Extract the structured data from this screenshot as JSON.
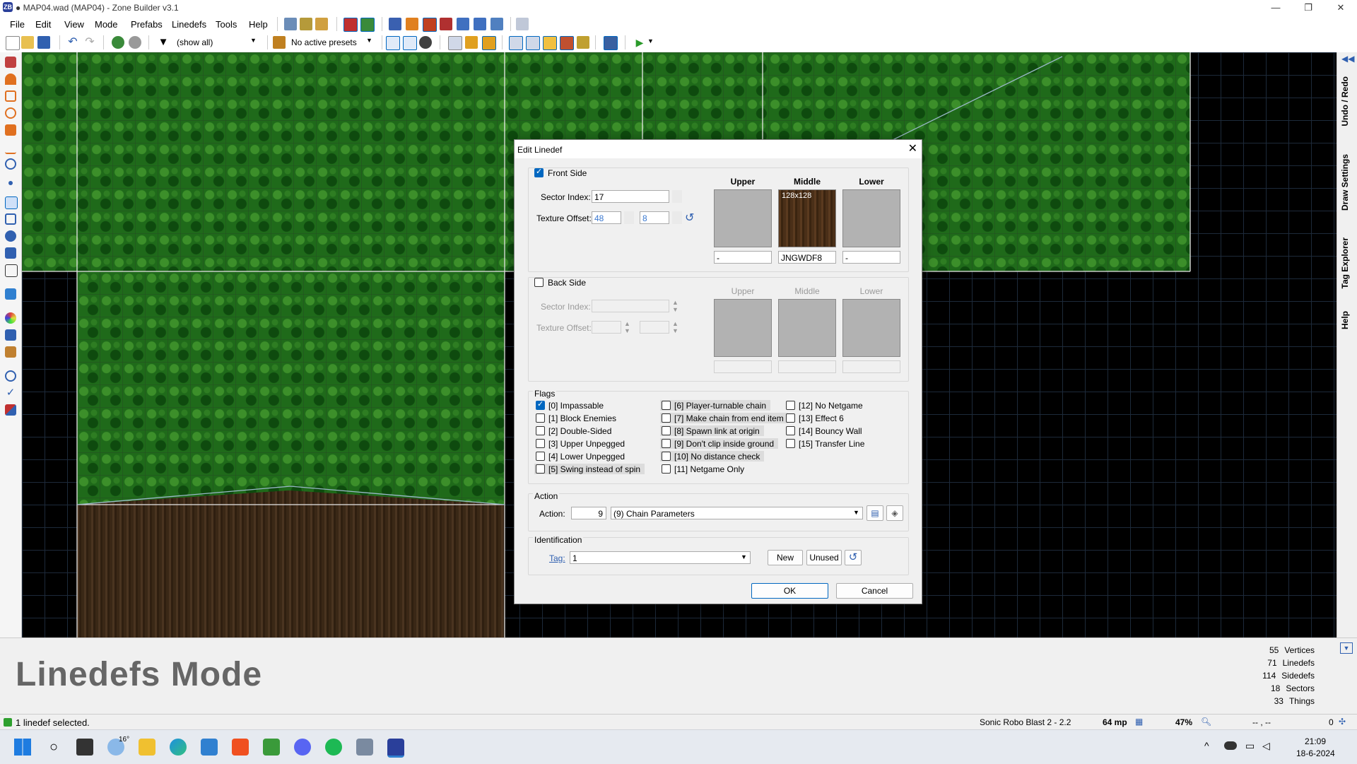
{
  "window": {
    "title": "● MAP04.wad (MAP04) - Zone Builder v3.1",
    "app_icon": "ZB",
    "controls": [
      "—",
      "❐",
      "✕"
    ]
  },
  "menu": [
    "File",
    "Edit",
    "View",
    "Mode",
    "Prefabs",
    "Linedefs",
    "Tools",
    "Help"
  ],
  "toolbar": {
    "filter_label": "(show all)",
    "presets_label": "No active presets"
  },
  "right_tabs": [
    "Undo / Redo",
    "Draw Settings",
    "Tag Explorer",
    "Help"
  ],
  "info": {
    "mode_title": "Linedefs Mode",
    "stats": [
      {
        "count": "55",
        "label": "Vertices"
      },
      {
        "count": "71",
        "label": "Linedefs"
      },
      {
        "count": "114",
        "label": "Sidedefs"
      },
      {
        "count": "18",
        "label": "Sectors"
      },
      {
        "count": "33",
        "label": "Things"
      }
    ]
  },
  "status": {
    "message": "1 linedef selected.",
    "game": "Sonic Robo Blast 2 - 2.2",
    "grid": "64 mp",
    "zoom": "47%",
    "coords": "-- , --",
    "right_value": "0"
  },
  "taskbar": {
    "weather_temp": "16°",
    "time": "21:09",
    "date": "18-6-2024"
  },
  "dialog": {
    "title": "Edit Linedef",
    "front": {
      "label": "Front Side",
      "checked": true,
      "sector_index_label": "Sector Index:",
      "sector_index": "17",
      "texture_offset_label": "Texture Offset:",
      "offset_x": "48",
      "offset_y": "8",
      "headers": [
        "Upper",
        "Middle",
        "Lower"
      ],
      "upper_tex": "-",
      "middle_tex": "JNGWDF8",
      "middle_size": "128x128",
      "lower_tex": "-"
    },
    "back": {
      "label": "Back Side",
      "checked": false,
      "sector_index_label": "Sector Index:",
      "texture_offset_label": "Texture Offset:",
      "headers": [
        "Upper",
        "Middle",
        "Lower"
      ]
    },
    "flags_label": "Flags",
    "flags_col1": [
      {
        "label": "[0] Impassable",
        "checked": true,
        "hl": false
      },
      {
        "label": "[1] Block Enemies",
        "checked": false,
        "hl": false
      },
      {
        "label": "[2] Double-Sided",
        "checked": false,
        "hl": false
      },
      {
        "label": "[3] Upper Unpegged",
        "checked": false,
        "hl": false
      },
      {
        "label": "[4] Lower Unpegged",
        "checked": false,
        "hl": false
      },
      {
        "label": "[5] Swing instead of spin",
        "checked": false,
        "hl": true
      }
    ],
    "flags_col2": [
      {
        "label": "[6] Player-turnable chain",
        "checked": false,
        "hl": true
      },
      {
        "label": "[7] Make chain from end item",
        "checked": false,
        "hl": true
      },
      {
        "label": "[8] Spawn link at origin",
        "checked": false,
        "hl": true
      },
      {
        "label": "[9] Don't clip inside ground",
        "checked": false,
        "hl": true
      },
      {
        "label": "[10] No distance check",
        "checked": false,
        "hl": true
      },
      {
        "label": "[11] Netgame Only",
        "checked": false,
        "hl": false
      }
    ],
    "flags_col3": [
      {
        "label": "[12] No Netgame",
        "checked": false,
        "hl": false
      },
      {
        "label": "[13] Effect 6",
        "checked": false,
        "hl": false
      },
      {
        "label": "[14] Bouncy Wall",
        "checked": false,
        "hl": false
      },
      {
        "label": "[15] Transfer Line",
        "checked": false,
        "hl": false
      }
    ],
    "action_group": "Action",
    "action_label": "Action:",
    "action_number": "9",
    "action_value": "(9) Chain Parameters",
    "ident_group": "Identification",
    "tag_label": "Tag:",
    "tag_value": "1",
    "new_label": "New",
    "unused_label": "Unused",
    "ok_label": "OK",
    "cancel_label": "Cancel"
  }
}
